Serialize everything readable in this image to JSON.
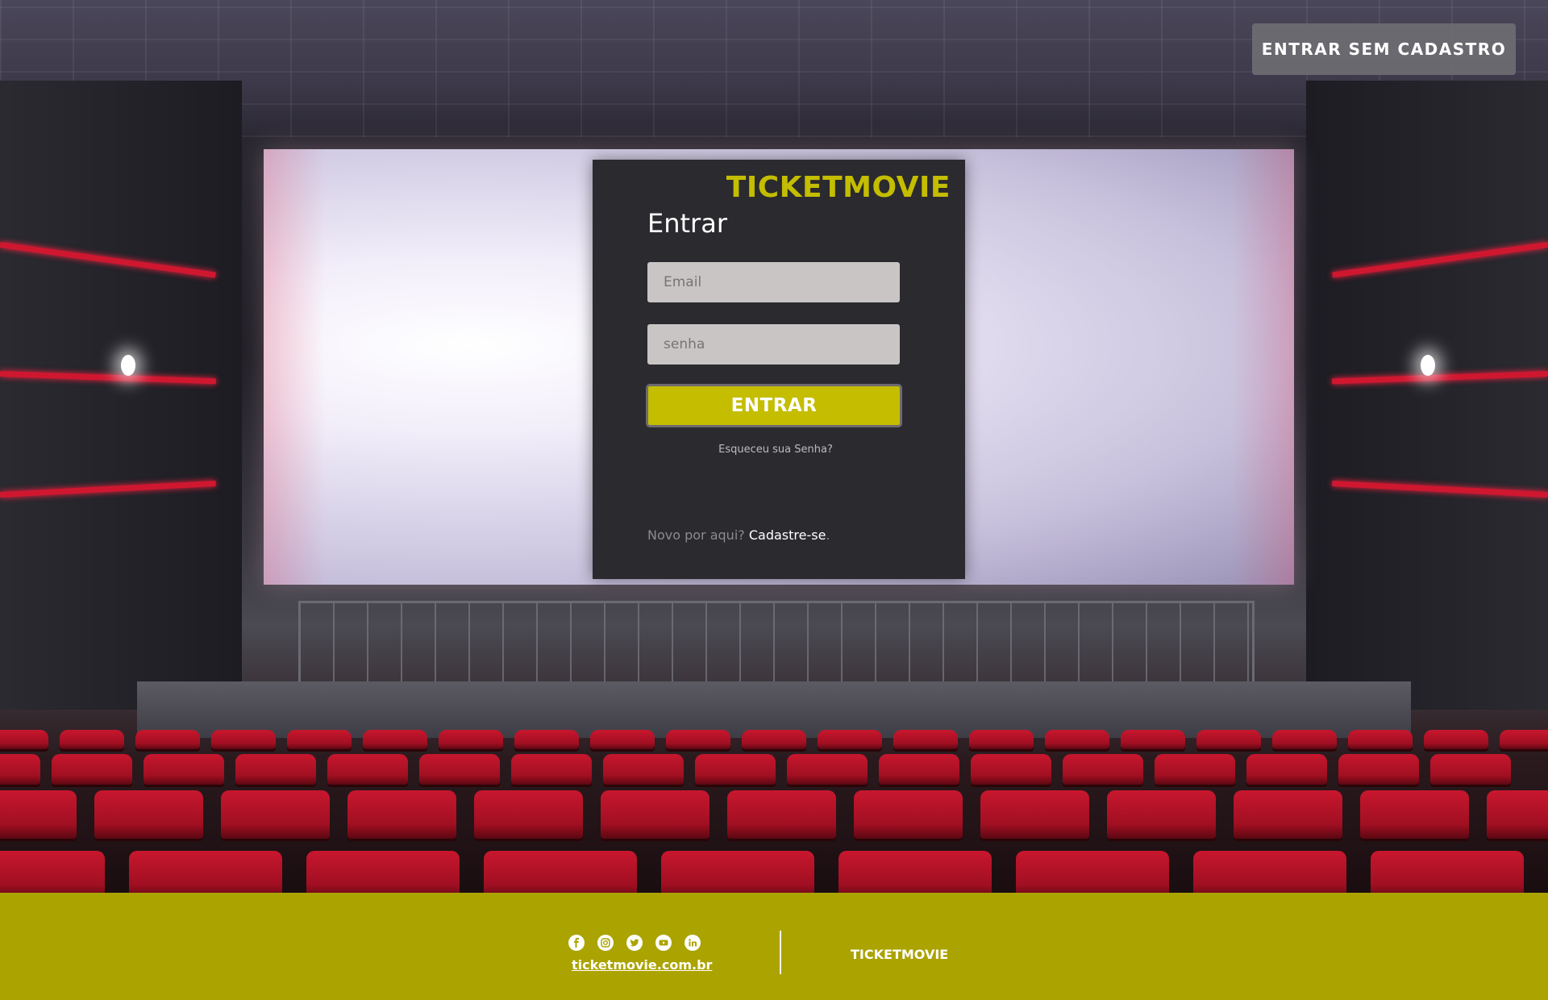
{
  "header": {
    "guest_button_label": "ENTRAR SEM CADASTRO"
  },
  "login": {
    "brand": "TICKETMOVIE",
    "title": "Entrar",
    "email_placeholder": "Email",
    "password_placeholder": "senha",
    "submit_label": "ENTRAR",
    "forgot_label": "Esqueceu sua Senha?",
    "new_user_text": "Novo por aqui?",
    "signup_label": "Cadastre-se",
    "signup_suffix": "."
  },
  "footer": {
    "social_icons": [
      "facebook-icon",
      "instagram-icon",
      "twitter-icon",
      "youtube-icon",
      "linkedin-icon"
    ],
    "site_link": "ticketmovie.com.br",
    "brand": "TICKETMOVIE"
  },
  "colors": {
    "accent": "#c4bd00",
    "footer_bg": "#aba300",
    "panel_bg": "#2b2a2e",
    "input_bg": "#c9c5c5"
  }
}
